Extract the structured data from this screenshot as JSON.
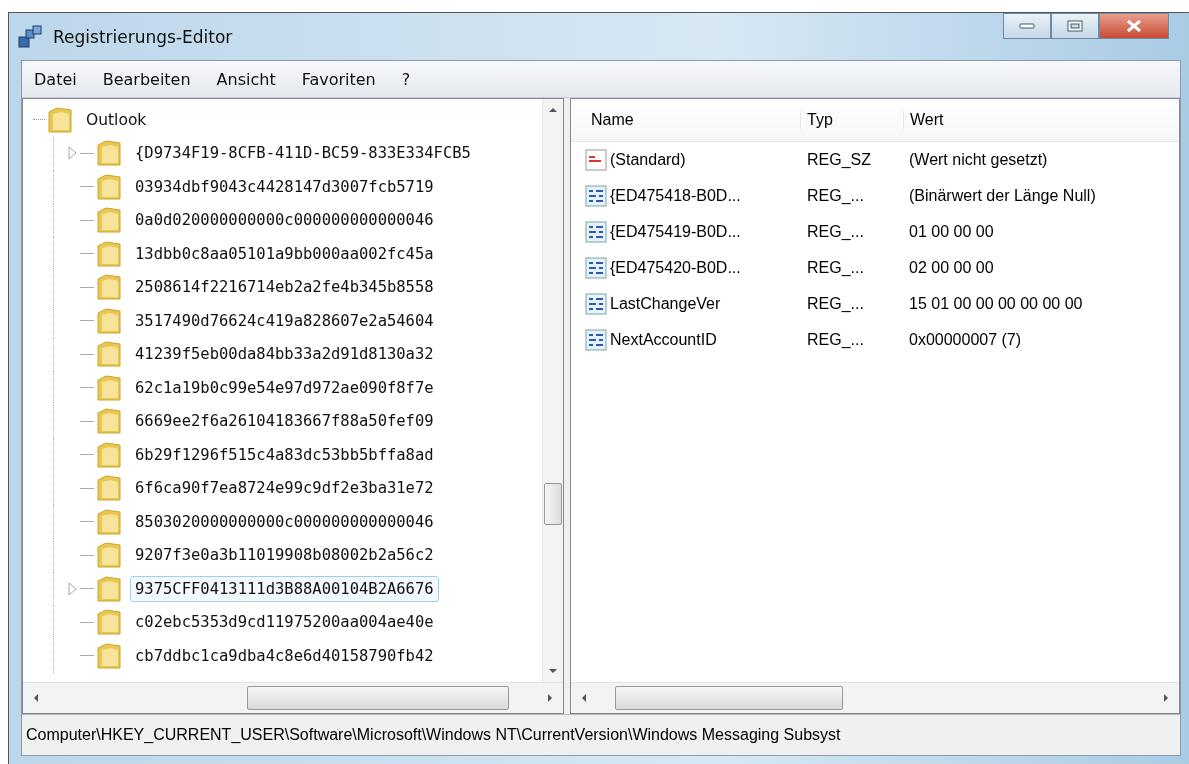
{
  "window": {
    "title": "Registrierungs-Editor"
  },
  "menu": [
    "Datei",
    "Bearbeiten",
    "Ansicht",
    "Favoriten",
    "?"
  ],
  "tree": {
    "label": "Outlook",
    "children": [
      {
        "label": "{D9734F19-8CFB-411D-BC59-833E334FCB5",
        "has_children": true,
        "selected": false
      },
      {
        "label": "03934dbf9043c4428147d3007fcb5719",
        "has_children": false,
        "selected": false
      },
      {
        "label": "0a0d020000000000c000000000000046",
        "has_children": false,
        "selected": false
      },
      {
        "label": "13dbb0c8aa05101a9bb000aa002fc45a",
        "has_children": false,
        "selected": false
      },
      {
        "label": "2508614f2216714eb2a2fe4b345b8558",
        "has_children": false,
        "selected": false
      },
      {
        "label": "3517490d76624c419a828607e2a54604",
        "has_children": false,
        "selected": false
      },
      {
        "label": "41239f5eb00da84bb33a2d91d8130a32",
        "has_children": false,
        "selected": false
      },
      {
        "label": "62c1a19b0c99e54e97d972ae090f8f7e",
        "has_children": false,
        "selected": false
      },
      {
        "label": "6669ee2f6a26104183667f88a50fef09",
        "has_children": false,
        "selected": false
      },
      {
        "label": "6b29f1296f515c4a83dc53bb5bffa8ad",
        "has_children": false,
        "selected": false
      },
      {
        "label": "6f6ca90f7ea8724e99c9df2e3ba31e72",
        "has_children": false,
        "selected": false
      },
      {
        "label": "8503020000000000c000000000000046",
        "has_children": false,
        "selected": false
      },
      {
        "label": "9207f3e0a3b11019908b08002b2a56c2",
        "has_children": false,
        "selected": false
      },
      {
        "label": "9375CFF0413111d3B88A00104B2A6676",
        "has_children": true,
        "selected": true
      },
      {
        "label": "c02ebc5353d9cd11975200aa004ae40e",
        "has_children": false,
        "selected": false
      },
      {
        "label": "cb7ddbc1ca9dba4c8e6d40158790fb42",
        "has_children": false,
        "selected": false
      }
    ]
  },
  "list": {
    "columns": [
      "Name",
      "Typ",
      "Wert"
    ],
    "rows": [
      {
        "kind": "string",
        "name": "(Standard)",
        "type": "REG_SZ",
        "value": "(Wert nicht gesetzt)"
      },
      {
        "kind": "binary",
        "name": "{ED475418-B0D...",
        "type": "REG_...",
        "value": "(Binärwert der Länge Null)"
      },
      {
        "kind": "binary",
        "name": "{ED475419-B0D...",
        "type": "REG_...",
        "value": "01 00 00 00"
      },
      {
        "kind": "binary",
        "name": "{ED475420-B0D...",
        "type": "REG_...",
        "value": "02 00 00 00"
      },
      {
        "kind": "binary",
        "name": "LastChangeVer",
        "type": "REG_...",
        "value": "15 01 00 00 00 00 00 00"
      },
      {
        "kind": "binary",
        "name": "NextAccountID",
        "type": "REG_...",
        "value": "0x00000007 (7)"
      }
    ]
  },
  "status_bar": "Computer\\HKEY_CURRENT_USER\\Software\\Microsoft\\Windows NT\\CurrentVersion\\Windows Messaging Subsyst"
}
